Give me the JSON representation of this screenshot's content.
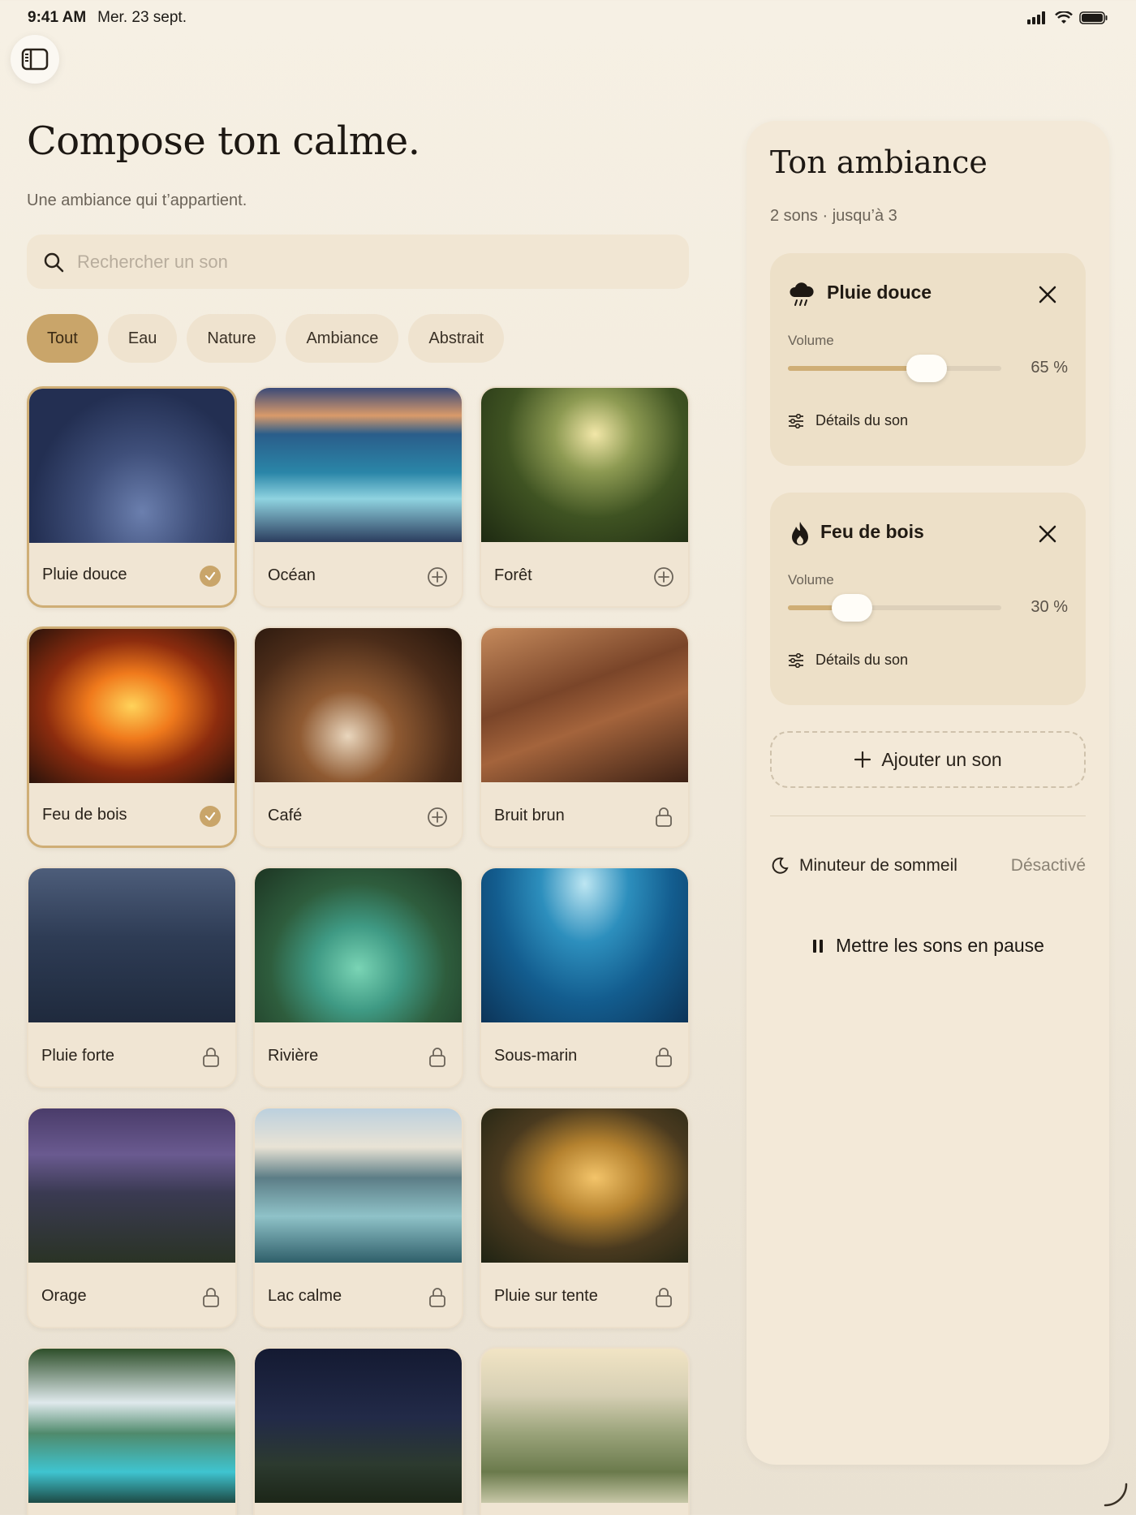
{
  "status": {
    "time": "9:41 AM",
    "date": "Mer. 23 sept."
  },
  "header": {
    "title": "Compose ton calme.",
    "subtitle": "Une ambiance qui t’appartient."
  },
  "search": {
    "placeholder": "Rechercher un son",
    "value": ""
  },
  "filters": [
    "Tout",
    "Eau",
    "Nature",
    "Ambiance",
    "Abstrait"
  ],
  "active_filter": "Tout",
  "sounds": [
    {
      "label": "Pluie douce",
      "state": "selected",
      "theme": "img-rain"
    },
    {
      "label": "Océan",
      "state": "add",
      "theme": "img-ocean"
    },
    {
      "label": "Forêt",
      "state": "add",
      "theme": "img-forest"
    },
    {
      "label": "Feu de bois",
      "state": "selected",
      "theme": "img-fire"
    },
    {
      "label": "Café",
      "state": "add",
      "theme": "img-cafe"
    },
    {
      "label": "Bruit brun",
      "state": "locked",
      "theme": "img-brown"
    },
    {
      "label": "Pluie forte",
      "state": "locked",
      "theme": "img-heavyrain"
    },
    {
      "label": "Rivière",
      "state": "locked",
      "theme": "img-river"
    },
    {
      "label": "Sous-marin",
      "state": "locked",
      "theme": "img-sub"
    },
    {
      "label": "Orage",
      "state": "locked",
      "theme": "img-storm"
    },
    {
      "label": "Lac calme",
      "state": "locked",
      "theme": "img-lake"
    },
    {
      "label": "Pluie sur tente",
      "state": "locked",
      "theme": "img-tent"
    },
    {
      "label": "",
      "state": "locked",
      "theme": "img-falls"
    },
    {
      "label": "",
      "state": "locked",
      "theme": "img-night"
    },
    {
      "label": "",
      "state": "locked",
      "theme": "img-meadow"
    }
  ],
  "panel": {
    "title": "Ton ambiance",
    "subtitle": "2 sons · jusqu’à 3",
    "mixes": [
      {
        "name": "Pluie douce",
        "icon": "rain-cloud-icon",
        "volume_label": "Volume",
        "volume": 65,
        "volume_text": "65 %",
        "details": "Détails du son"
      },
      {
        "name": "Feu de bois",
        "icon": "flame-icon",
        "volume_label": "Volume",
        "volume": 30,
        "volume_text": "30 %",
        "details": "Détails du son"
      }
    ],
    "add_label": "Ajouter un son",
    "timer_label": "Minuteur de sommeil",
    "timer_value": "Désactivé",
    "pause_label": "Mettre les sons en pause"
  },
  "colors": {
    "accent": "#c9a56a",
    "panel": "#f3e9d8",
    "card": "#f0e5d3"
  }
}
